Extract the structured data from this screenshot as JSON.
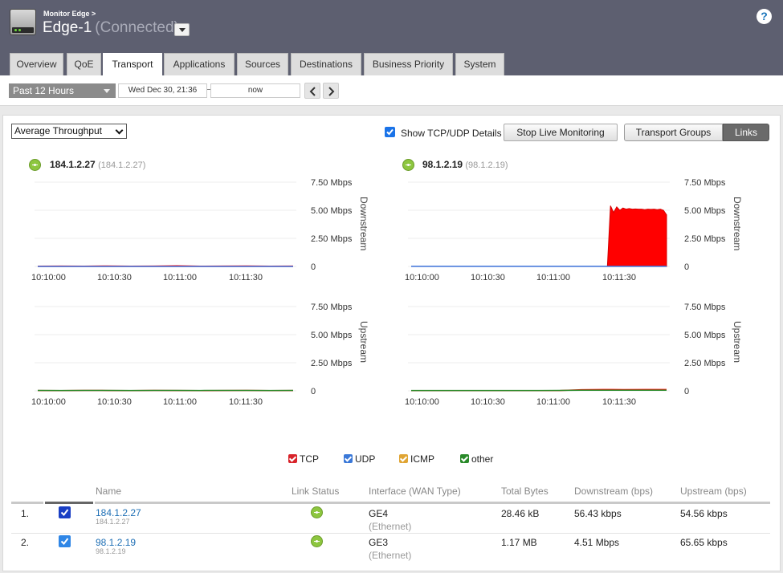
{
  "header": {
    "breadcrumb": "Monitor Edge >",
    "edge_name": "Edge-1",
    "edge_status": "(Connected)",
    "help_icon": "?"
  },
  "tabs": [
    {
      "label": "Overview"
    },
    {
      "label": "QoE"
    },
    {
      "label": "Transport",
      "active": true
    },
    {
      "label": "Applications"
    },
    {
      "label": "Sources"
    },
    {
      "label": "Destinations"
    },
    {
      "label": "Business Priority"
    },
    {
      "label": "System"
    }
  ],
  "timebar": {
    "range": "Past 12 Hours",
    "start": "Wed Dec 30, 21:36",
    "end": "now"
  },
  "controls": {
    "metric": "Average Throughput",
    "show_details_label": "Show TCP/UDP Details",
    "show_details_checked": true,
    "stop_button": "Stop Live Monitoring",
    "transport_groups": "Transport Groups",
    "links": "Links"
  },
  "links": [
    {
      "name": "184.1.2.27",
      "sub": "(184.1.2.27)",
      "ip": "184.1.2.27",
      "interface": "GE4",
      "wan_type": "(Ethernet)",
      "total_bytes": "28.46 kB",
      "downstream": "56.43 kbps",
      "upstream": "54.56 kbps",
      "index": "1.",
      "checked": true
    },
    {
      "name": "98.1.2.19",
      "sub": "(98.1.2.19)",
      "ip": "98.1.2.19",
      "interface": "GE3",
      "wan_type": "(Ethernet)",
      "total_bytes": "1.17 MB",
      "downstream": "4.51 Mbps",
      "upstream": "65.65 kbps",
      "index": "2.",
      "checked": true
    }
  ],
  "chart_data": [
    {
      "type": "area",
      "link": "184.1.2.27",
      "ylabel": "Downstream",
      "y_ticks": [
        "7.50 Mbps",
        "5.00 Mbps",
        "2.50 Mbps",
        "0"
      ],
      "ylim": [
        0,
        7.5
      ],
      "x_ticks": [
        "10:10:00",
        "10:10:30",
        "10:11:00",
        "10:11:30"
      ],
      "series": [
        {
          "name": "TCP",
          "color": "#ff0000",
          "values": [
            0.02,
            0.03,
            0.02,
            0.04,
            0.02,
            0.03,
            0.05,
            0.02,
            0.03,
            0.04,
            0.02,
            0.03
          ]
        },
        {
          "name": "UDP",
          "color": "#3a6fd8",
          "values": [
            0,
            0,
            0,
            0,
            0,
            0,
            0,
            0,
            0,
            0,
            0,
            0
          ]
        }
      ]
    },
    {
      "type": "area",
      "link": "98.1.2.19",
      "ylabel": "Downstream",
      "y_ticks": [
        "7.50 Mbps",
        "5.00 Mbps",
        "2.50 Mbps",
        "0"
      ],
      "ylim": [
        0,
        7.5
      ],
      "x_ticks": [
        "10:10:00",
        "10:10:30",
        "10:11:00",
        "10:11:30"
      ],
      "series": [
        {
          "name": "TCP",
          "color": "#ff0000",
          "values": [
            0,
            0,
            0,
            0,
            0,
            0,
            0,
            0,
            0,
            0,
            0,
            0,
            0,
            0,
            0,
            0,
            0,
            0,
            0,
            0,
            0,
            0,
            0,
            0,
            0,
            0,
            0,
            0,
            0,
            0,
            0,
            0,
            0,
            0,
            0,
            0,
            0,
            0,
            0,
            0,
            0,
            0,
            0,
            0,
            0,
            0,
            0,
            0,
            0,
            0,
            0,
            0,
            0,
            0,
            0,
            0,
            0,
            0,
            0,
            0,
            0,
            0,
            0,
            0,
            5.4,
            4.8,
            5.3,
            5.0,
            5.2,
            5.1,
            5.15,
            5.1,
            5.12,
            5.1,
            5.1,
            5.05,
            5.1,
            5.08,
            5.1,
            5.05,
            5.1,
            5.0,
            4.6
          ]
        },
        {
          "name": "UDP",
          "color": "#3a6fd8",
          "values": [
            0.01,
            0.01,
            0.01,
            0.01,
            0.01,
            0.01,
            0.01,
            0.01,
            0.01,
            0.01,
            0.01,
            0.01
          ]
        }
      ]
    },
    {
      "type": "area",
      "link": "184.1.2.27",
      "ylabel": "Upstream",
      "y_ticks": [
        "7.50 Mbps",
        "5.00 Mbps",
        "2.50 Mbps",
        "0"
      ],
      "ylim": [
        0,
        7.5
      ],
      "x_ticks": [
        "10:10:00",
        "10:10:30",
        "10:11:00",
        "10:11:30"
      ],
      "series": [
        {
          "name": "TCP",
          "color": "#ff0000",
          "values": [
            0.03,
            0.02,
            0.04,
            0.03,
            0.02,
            0.04,
            0.03,
            0.02,
            0.03,
            0.04,
            0.02,
            0.03
          ]
        },
        {
          "name": "other",
          "color": "#2a8a2a",
          "values": [
            0.04,
            0.03,
            0.04,
            0.04,
            0.03,
            0.04,
            0.04,
            0.03,
            0.04,
            0.04,
            0.03,
            0.04
          ]
        }
      ]
    },
    {
      "type": "area",
      "link": "98.1.2.19",
      "ylabel": "Upstream",
      "y_ticks": [
        "7.50 Mbps",
        "5.00 Mbps",
        "2.50 Mbps",
        "0"
      ],
      "ylim": [
        0,
        7.5
      ],
      "x_ticks": [
        "10:10:00",
        "10:10:30",
        "10:11:00",
        "10:11:30"
      ],
      "series": [
        {
          "name": "TCP",
          "color": "#ff0000",
          "values": [
            0.02,
            0.02,
            0.02,
            0.02,
            0.02,
            0.02,
            0.02,
            0.03,
            0.1,
            0.12,
            0.11,
            0.12,
            0.12
          ]
        },
        {
          "name": "other",
          "color": "#2a8a2a",
          "values": [
            0.03,
            0.03,
            0.03,
            0.03,
            0.03,
            0.03,
            0.03,
            0.04,
            0.05,
            0.05,
            0.05,
            0.05,
            0.05
          ]
        }
      ]
    }
  ],
  "legend": [
    {
      "label": "TCP",
      "color": "#d8232a"
    },
    {
      "label": "UDP",
      "color": "#3a78d8"
    },
    {
      "label": "ICMP",
      "color": "#e0a534"
    },
    {
      "label": "other",
      "color": "#2a8a2a"
    }
  ],
  "table": {
    "headers": {
      "name": "Name",
      "link_status": "Link Status",
      "interface": "Interface (WAN Type)",
      "total_bytes": "Total Bytes",
      "downstream": "Downstream (bps)",
      "upstream": "Upstream (bps)"
    }
  }
}
